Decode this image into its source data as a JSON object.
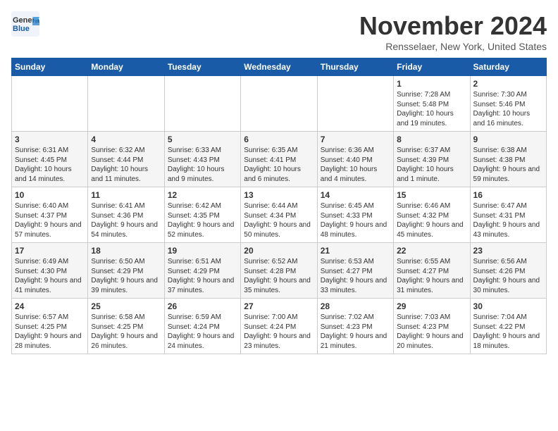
{
  "header": {
    "logo_general": "General",
    "logo_blue": "Blue",
    "month": "November 2024",
    "location": "Rensselaer, New York, United States"
  },
  "weekdays": [
    "Sunday",
    "Monday",
    "Tuesday",
    "Wednesday",
    "Thursday",
    "Friday",
    "Saturday"
  ],
  "weeks": [
    [
      {
        "day": "",
        "info": ""
      },
      {
        "day": "",
        "info": ""
      },
      {
        "day": "",
        "info": ""
      },
      {
        "day": "",
        "info": ""
      },
      {
        "day": "",
        "info": ""
      },
      {
        "day": "1",
        "info": "Sunrise: 7:28 AM\nSunset: 5:48 PM\nDaylight: 10 hours\nand 19 minutes."
      },
      {
        "day": "2",
        "info": "Sunrise: 7:30 AM\nSunset: 5:46 PM\nDaylight: 10 hours\nand 16 minutes."
      }
    ],
    [
      {
        "day": "3",
        "info": "Sunrise: 6:31 AM\nSunset: 4:45 PM\nDaylight: 10 hours\nand 14 minutes."
      },
      {
        "day": "4",
        "info": "Sunrise: 6:32 AM\nSunset: 4:44 PM\nDaylight: 10 hours\nand 11 minutes."
      },
      {
        "day": "5",
        "info": "Sunrise: 6:33 AM\nSunset: 4:43 PM\nDaylight: 10 hours\nand 9 minutes."
      },
      {
        "day": "6",
        "info": "Sunrise: 6:35 AM\nSunset: 4:41 PM\nDaylight: 10 hours\nand 6 minutes."
      },
      {
        "day": "7",
        "info": "Sunrise: 6:36 AM\nSunset: 4:40 PM\nDaylight: 10 hours\nand 4 minutes."
      },
      {
        "day": "8",
        "info": "Sunrise: 6:37 AM\nSunset: 4:39 PM\nDaylight: 10 hours\nand 1 minute."
      },
      {
        "day": "9",
        "info": "Sunrise: 6:38 AM\nSunset: 4:38 PM\nDaylight: 9 hours\nand 59 minutes."
      }
    ],
    [
      {
        "day": "10",
        "info": "Sunrise: 6:40 AM\nSunset: 4:37 PM\nDaylight: 9 hours\nand 57 minutes."
      },
      {
        "day": "11",
        "info": "Sunrise: 6:41 AM\nSunset: 4:36 PM\nDaylight: 9 hours\nand 54 minutes."
      },
      {
        "day": "12",
        "info": "Sunrise: 6:42 AM\nSunset: 4:35 PM\nDaylight: 9 hours\nand 52 minutes."
      },
      {
        "day": "13",
        "info": "Sunrise: 6:44 AM\nSunset: 4:34 PM\nDaylight: 9 hours\nand 50 minutes."
      },
      {
        "day": "14",
        "info": "Sunrise: 6:45 AM\nSunset: 4:33 PM\nDaylight: 9 hours\nand 48 minutes."
      },
      {
        "day": "15",
        "info": "Sunrise: 6:46 AM\nSunset: 4:32 PM\nDaylight: 9 hours\nand 45 minutes."
      },
      {
        "day": "16",
        "info": "Sunrise: 6:47 AM\nSunset: 4:31 PM\nDaylight: 9 hours\nand 43 minutes."
      }
    ],
    [
      {
        "day": "17",
        "info": "Sunrise: 6:49 AM\nSunset: 4:30 PM\nDaylight: 9 hours\nand 41 minutes."
      },
      {
        "day": "18",
        "info": "Sunrise: 6:50 AM\nSunset: 4:29 PM\nDaylight: 9 hours\nand 39 minutes."
      },
      {
        "day": "19",
        "info": "Sunrise: 6:51 AM\nSunset: 4:29 PM\nDaylight: 9 hours\nand 37 minutes."
      },
      {
        "day": "20",
        "info": "Sunrise: 6:52 AM\nSunset: 4:28 PM\nDaylight: 9 hours\nand 35 minutes."
      },
      {
        "day": "21",
        "info": "Sunrise: 6:53 AM\nSunset: 4:27 PM\nDaylight: 9 hours\nand 33 minutes."
      },
      {
        "day": "22",
        "info": "Sunrise: 6:55 AM\nSunset: 4:27 PM\nDaylight: 9 hours\nand 31 minutes."
      },
      {
        "day": "23",
        "info": "Sunrise: 6:56 AM\nSunset: 4:26 PM\nDaylight: 9 hours\nand 30 minutes."
      }
    ],
    [
      {
        "day": "24",
        "info": "Sunrise: 6:57 AM\nSunset: 4:25 PM\nDaylight: 9 hours\nand 28 minutes."
      },
      {
        "day": "25",
        "info": "Sunrise: 6:58 AM\nSunset: 4:25 PM\nDaylight: 9 hours\nand 26 minutes."
      },
      {
        "day": "26",
        "info": "Sunrise: 6:59 AM\nSunset: 4:24 PM\nDaylight: 9 hours\nand 24 minutes."
      },
      {
        "day": "27",
        "info": "Sunrise: 7:00 AM\nSunset: 4:24 PM\nDaylight: 9 hours\nand 23 minutes."
      },
      {
        "day": "28",
        "info": "Sunrise: 7:02 AM\nSunset: 4:23 PM\nDaylight: 9 hours\nand 21 minutes."
      },
      {
        "day": "29",
        "info": "Sunrise: 7:03 AM\nSunset: 4:23 PM\nDaylight: 9 hours\nand 20 minutes."
      },
      {
        "day": "30",
        "info": "Sunrise: 7:04 AM\nSunset: 4:22 PM\nDaylight: 9 hours\nand 18 minutes."
      }
    ]
  ]
}
